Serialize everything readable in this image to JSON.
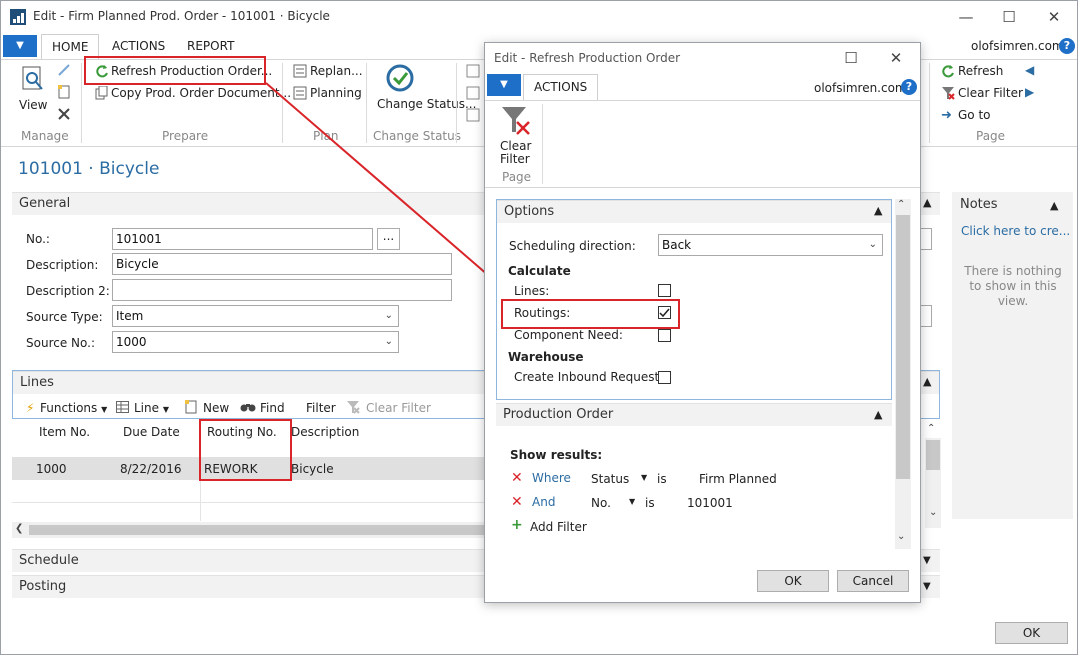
{
  "window": {
    "title": "Edit - Firm Planned Prod. Order - 101001 · Bicycle",
    "user": "olofsimren.com"
  },
  "tabs": [
    "HOME",
    "ACTIONS",
    "REPORT"
  ],
  "ribbon": {
    "view": "View",
    "manage": "Manage",
    "refresh_prod_order": "Refresh Production Order...",
    "copy_prod_order": "Copy Prod. Order Document...",
    "prepare": "Prepare",
    "replan": "Replan...",
    "planning": "Planning",
    "plan": "Plan",
    "change_status": "Change Status...",
    "change_status_group": "Change Status",
    "refresh": "Refresh",
    "clear_filter": "Clear Filter",
    "go_to": "Go to",
    "page": "Page"
  },
  "page_title": "101001 · Bicycle",
  "general": {
    "header": "General",
    "no_label": "No.:",
    "no_value": "101001",
    "lookup": "...",
    "desc_label": "Description:",
    "desc_value": "Bicycle",
    "desc2_label": "Description 2:",
    "desc2_value": "",
    "source_type_label": "Source Type:",
    "source_type_value": "Item",
    "source_no_label": "Source No.:",
    "source_no_value": "1000"
  },
  "lines": {
    "header": "Lines",
    "toolbar": {
      "functions": "Functions",
      "line": "Line",
      "new": "New",
      "find": "Find",
      "filter": "Filter",
      "clear_filter": "Clear Filter"
    },
    "columns": [
      "Item No.",
      "Due Date",
      "Routing No.",
      "Description"
    ],
    "row": [
      "1000",
      "8/22/2016",
      "REWORK",
      "Bicycle"
    ]
  },
  "schedule": "Schedule",
  "posting": "Posting",
  "notes": {
    "header": "Notes",
    "link": "Click here to cre...",
    "empty": "There is nothing to show in this view."
  },
  "main_ok": "OK",
  "dialog": {
    "title": "Edit - Refresh Production Order",
    "tab": "ACTIONS",
    "user": "olofsimren.com",
    "clear_filter_1": "Clear",
    "clear_filter_2": "Filter",
    "page": "Page",
    "options_header": "Options",
    "sched_dir_label": "Scheduling direction:",
    "sched_dir_value": "Back",
    "calculate": "Calculate",
    "lines_label": "Lines:",
    "routings_label": "Routings:",
    "component_label": "Component Need:",
    "warehouse": "Warehouse",
    "inbound_label": "Create Inbound Request:",
    "po_header": "Production Order",
    "show_results": "Show results:",
    "filters": [
      {
        "conj": "Where",
        "field": "Status",
        "op": "is",
        "value": "Firm Planned"
      },
      {
        "conj": "And",
        "field": "No.",
        "op": "is",
        "value": "101001"
      }
    ],
    "add_filter": "Add Filter",
    "ok": "OK",
    "cancel": "Cancel"
  }
}
